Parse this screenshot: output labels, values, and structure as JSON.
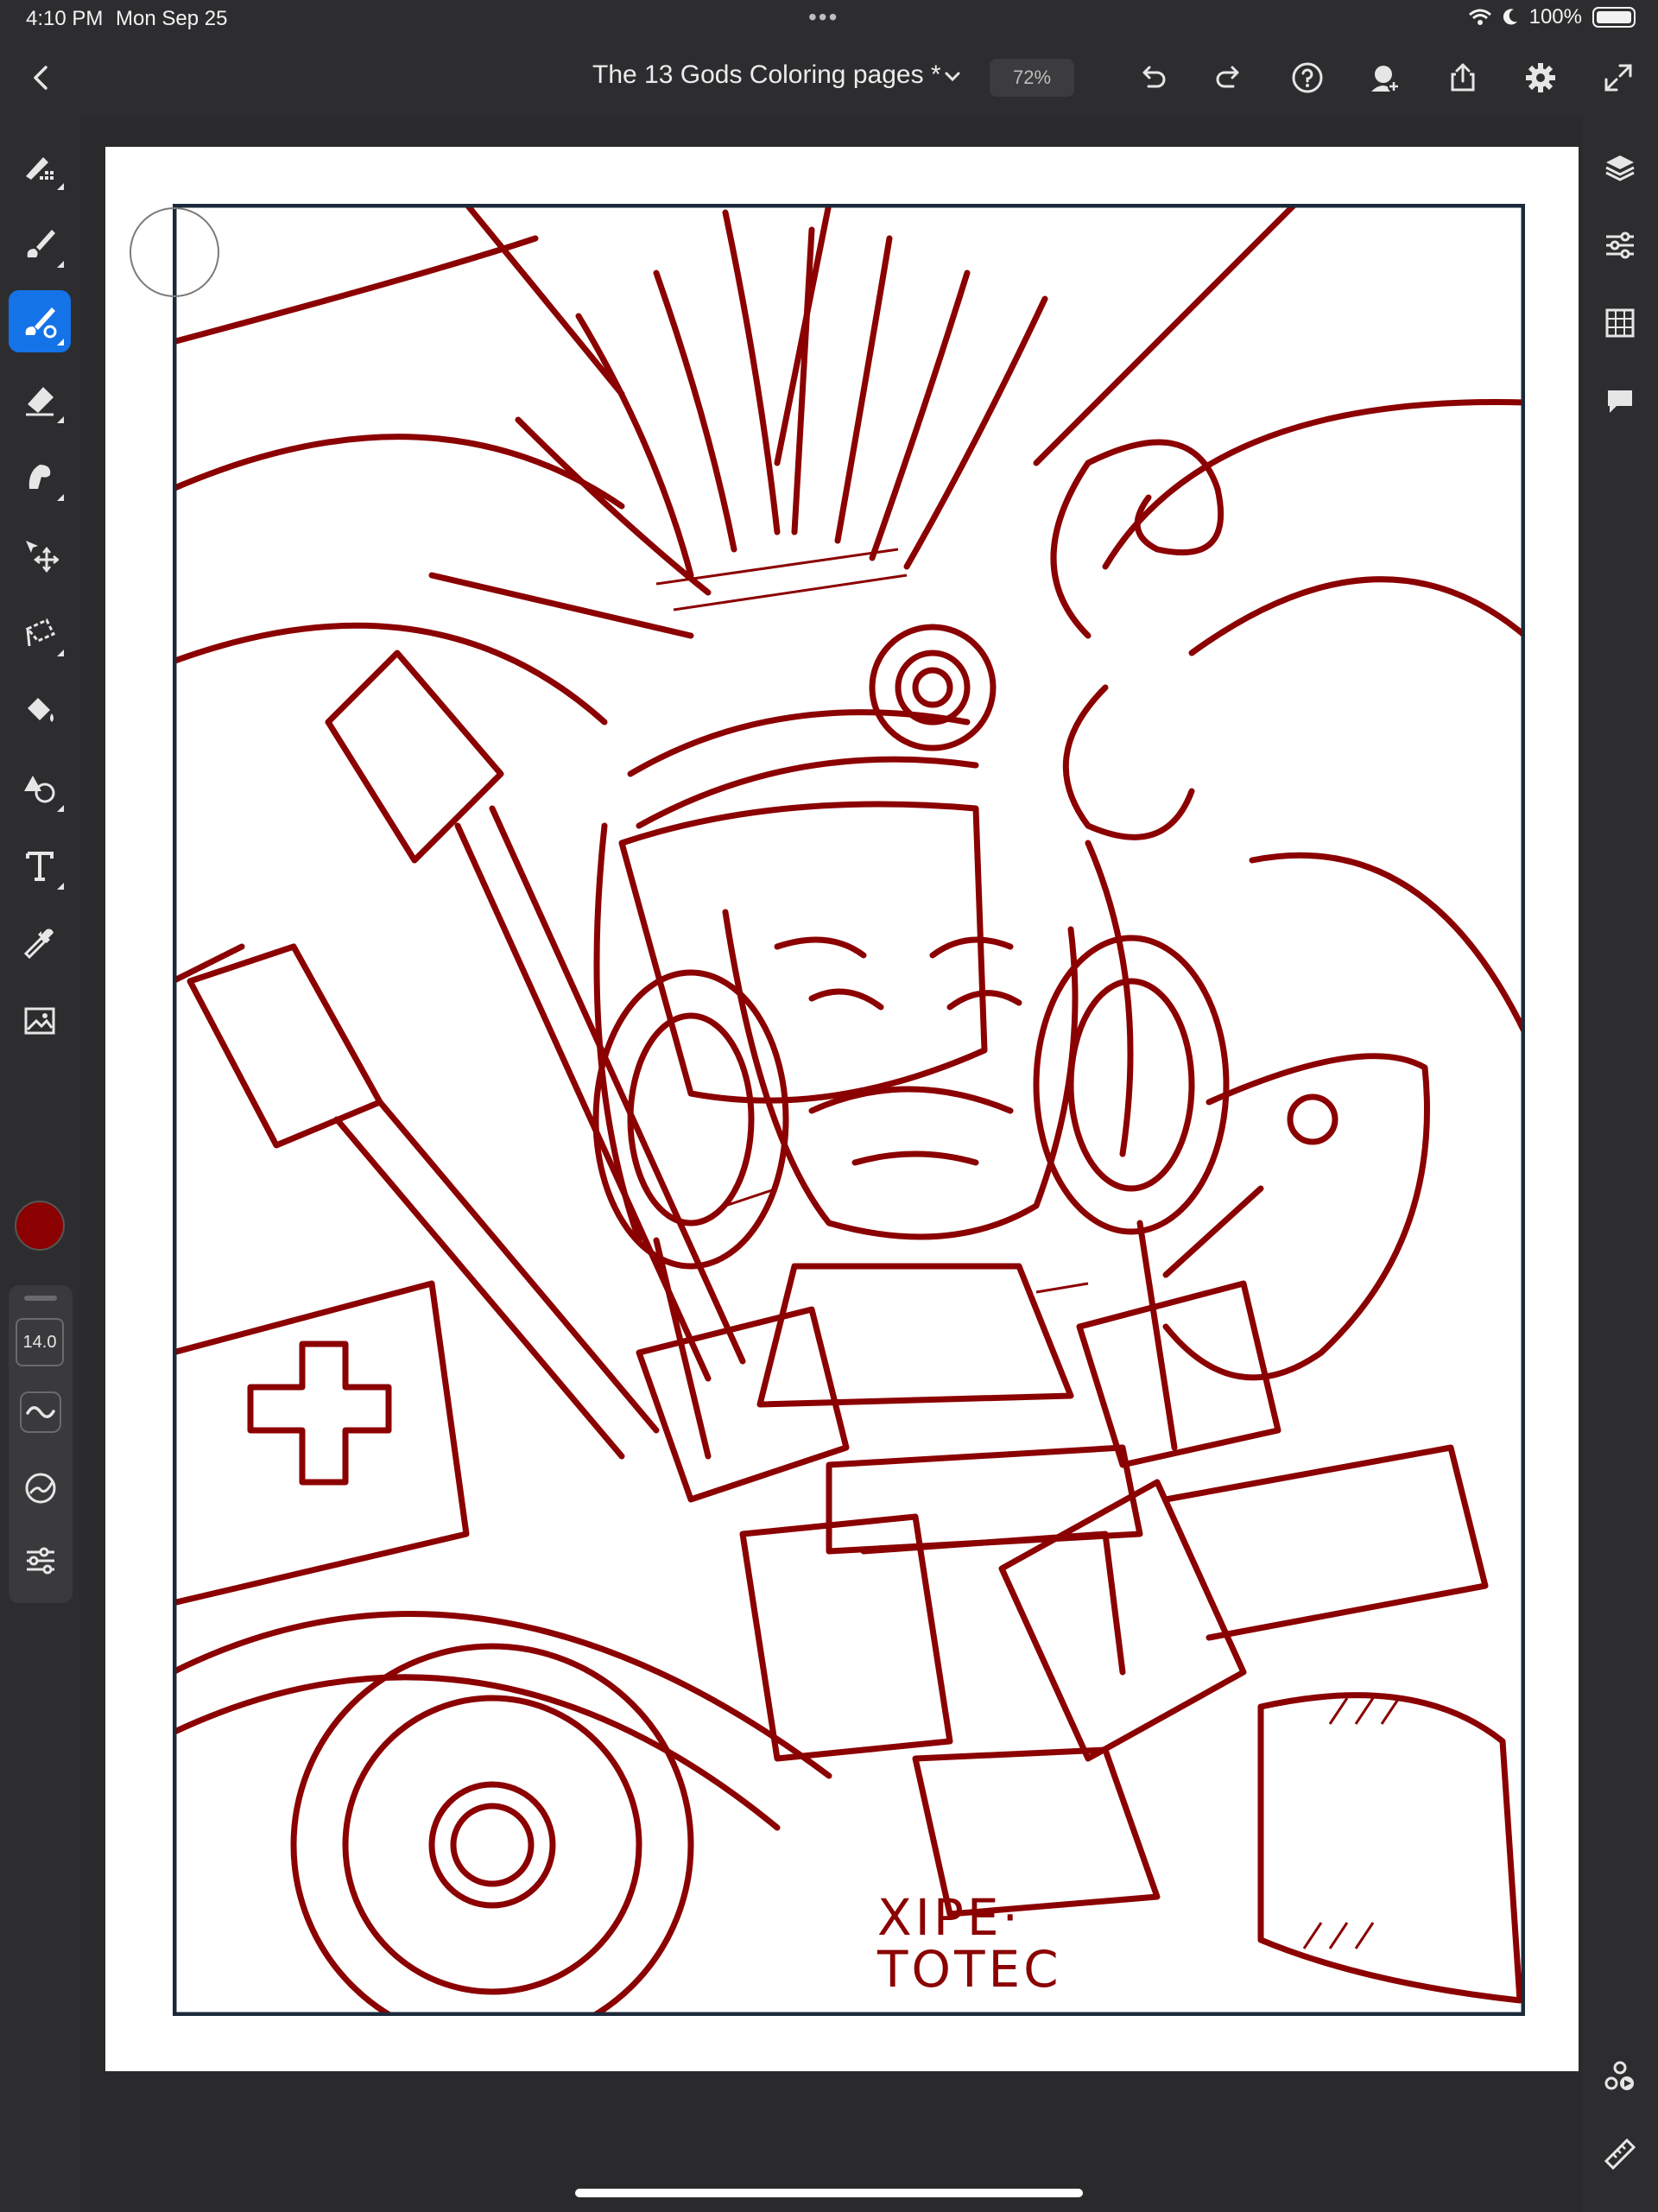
{
  "status_bar": {
    "time": "4:10 PM",
    "date": "Mon Sep 25",
    "battery": "100%"
  },
  "header": {
    "document_title": "The 13 Gods Coloring pages *",
    "zoom": "72%",
    "icons": [
      "back-icon",
      "title-chevron-icon",
      "undo-icon",
      "redo-icon",
      "help-icon",
      "invite-icon",
      "share-icon",
      "settings-icon",
      "fullscreen-icon"
    ]
  },
  "left_toolbar": {
    "tools": [
      "pixel-brush-icon",
      "live-brush-icon",
      "vector-brush-icon",
      "eraser-icon",
      "smudge-icon",
      "move-icon",
      "lasso-icon",
      "fill-icon",
      "shapes-icon",
      "text-icon",
      "eyedropper-icon",
      "image-icon"
    ],
    "active_tool": "vector-brush-icon",
    "color": "#8b0000",
    "brush_size": "14.0"
  },
  "right_toolbar": {
    "icons": [
      "layers-icon",
      "layer-properties-icon",
      "grid-icon",
      "comments-icon",
      "livestream-icon",
      "ruler-icon"
    ]
  },
  "artwork": {
    "signature_text": "XIPE· TOTEC",
    "line_color": "#8b0000",
    "frame_color": "#1b2a3a"
  }
}
